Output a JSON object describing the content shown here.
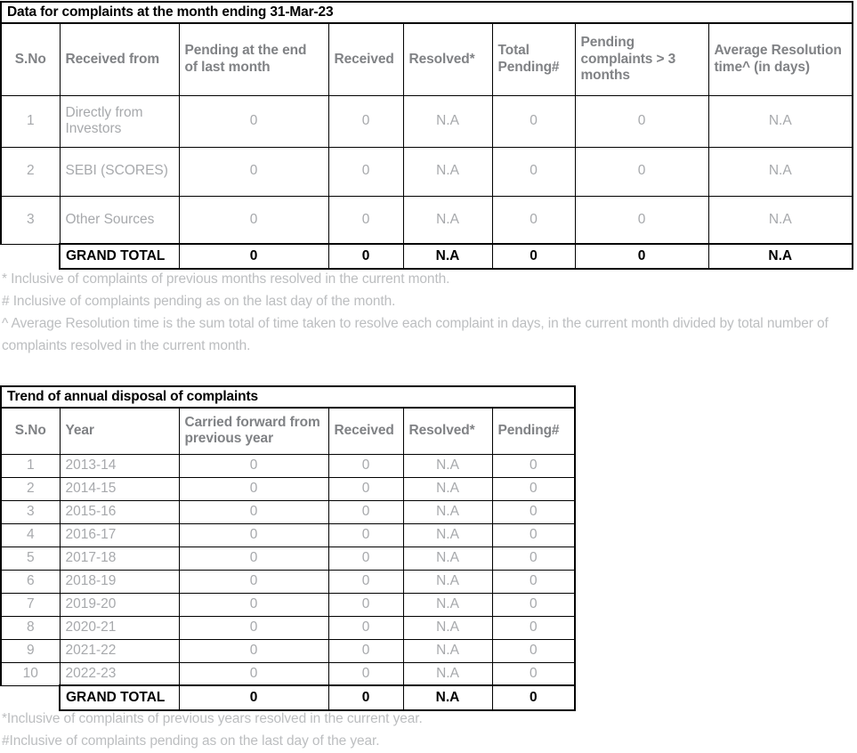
{
  "table1": {
    "title": "Data for complaints at the month ending 31-Mar-23",
    "headers": [
      "S.No",
      "Received from",
      "Pending at the end of last month",
      "Received",
      "Resolved*",
      "Total Pending#",
      "Pending complaints > 3 months",
      "Average Resolution time^ (in days)"
    ],
    "rows": [
      {
        "sno": "1",
        "source": "Directly from Investors",
        "pending_last_month": "0",
        "received": "0",
        "resolved": "N.A",
        "total_pending": "0",
        "pending_gt_3_months": "0",
        "avg_resolution_time": "N.A"
      },
      {
        "sno": "2",
        "source": "SEBI (SCORES)",
        "pending_last_month": "0",
        "received": "0",
        "resolved": "N.A",
        "total_pending": "0",
        "pending_gt_3_months": "0",
        "avg_resolution_time": "N.A"
      },
      {
        "sno": "3",
        "source": "Other Sources",
        "pending_last_month": "0",
        "received": "0",
        "resolved": "N.A",
        "total_pending": "0",
        "pending_gt_3_months": "0",
        "avg_resolution_time": "N.A"
      }
    ],
    "total": {
      "sno": "",
      "source": "GRAND TOTAL",
      "pending_last_month": "0",
      "received": "0",
      "resolved": "N.A",
      "total_pending": "0",
      "pending_gt_3_months": "0",
      "avg_resolution_time": "N.A"
    }
  },
  "notes1": [
    "* Inclusive of complaints of previous months resolved in the current month.",
    "# Inclusive of complaints pending as on the last day of the month.",
    "^ Average Resolution time is the sum total of time taken to resolve each complaint in days, in the current month divided by total number of complaints resolved in the current month."
  ],
  "table2": {
    "title": "Trend of annual disposal of complaints",
    "headers": [
      "S.No",
      "Year",
      "Carried forward from previous year",
      "Received",
      "Resolved*",
      "Pending#"
    ],
    "rows": [
      {
        "sno": "1",
        "year": "2013-14",
        "carried_forward": "0",
        "received": "0",
        "resolved": "N.A",
        "pending": "0"
      },
      {
        "sno": "2",
        "year": "2014-15",
        "carried_forward": "0",
        "received": "0",
        "resolved": "N.A",
        "pending": "0"
      },
      {
        "sno": "3",
        "year": "2015-16",
        "carried_forward": "0",
        "received": "0",
        "resolved": "N.A",
        "pending": "0"
      },
      {
        "sno": "4",
        "year": "2016-17",
        "carried_forward": "0",
        "received": "0",
        "resolved": "N.A",
        "pending": "0"
      },
      {
        "sno": "5",
        "year": "2017-18",
        "carried_forward": "0",
        "received": "0",
        "resolved": "N.A",
        "pending": "0"
      },
      {
        "sno": "6",
        "year": "2018-19",
        "carried_forward": "0",
        "received": "0",
        "resolved": "N.A",
        "pending": "0"
      },
      {
        "sno": "7",
        "year": "2019-20",
        "carried_forward": "0",
        "received": "0",
        "resolved": "N.A",
        "pending": "0"
      },
      {
        "sno": "8",
        "year": "2020-21",
        "carried_forward": "0",
        "received": "0",
        "resolved": "N.A",
        "pending": "0"
      },
      {
        "sno": "9",
        "year": "2021-22",
        "carried_forward": "0",
        "received": "0",
        "resolved": "N.A",
        "pending": "0"
      },
      {
        "sno": "10",
        "year": "2022-23",
        "carried_forward": "0",
        "received": "0",
        "resolved": "N.A",
        "pending": "0"
      }
    ],
    "total": {
      "sno": "",
      "year": "GRAND TOTAL",
      "carried_forward": "0",
      "received": "0",
      "resolved": "N.A",
      "pending": "0"
    }
  },
  "notes2": [
    "*Inclusive of complaints of previous years resolved in the current year.",
    "#Inclusive of complaints pending as on the last day of the year."
  ],
  "colors": {
    "header_text": "#808285",
    "body_text": "#a7a9ac",
    "note_text": "#bcbec0",
    "border": "#000000",
    "emphasis_text": "#000000"
  }
}
